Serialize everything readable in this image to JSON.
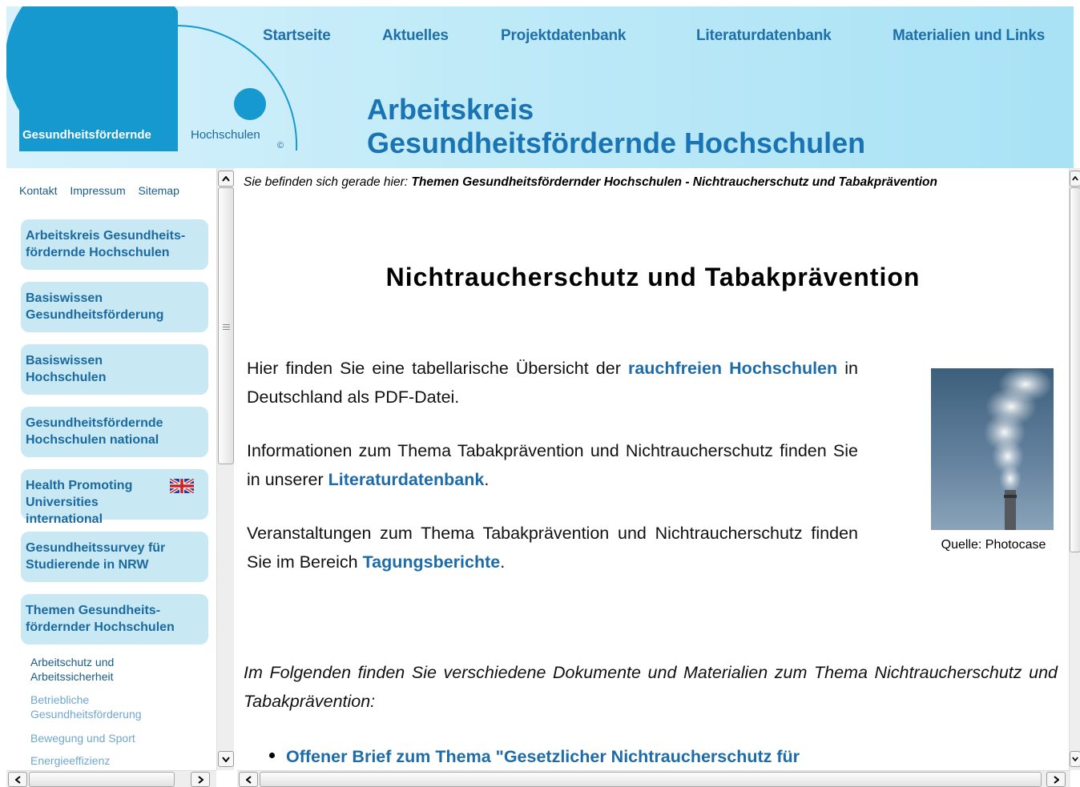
{
  "header": {
    "logo": {
      "left_text": "Gesundheitsfördernde",
      "right_text": "Hochschulen",
      "copyright": "©"
    },
    "nav": [
      "Startseite",
      "Aktuelles",
      "Projektdatenbank",
      "Literaturdatenbank",
      "Materialien und Links"
    ],
    "title_line1": "Arbeitskreis",
    "title_line2": "Gesundheitsfördernde Hochschulen"
  },
  "sidebar": {
    "util_links": [
      "Kontakt",
      "Impressum",
      "Sitemap"
    ],
    "boxes": [
      "Arbeitskreis Gesundheits- fördernde Hochschulen",
      "Basiswissen Gesundheitsförderung",
      "Basiswissen Hochschulen",
      "Gesundheitsfördernde Hochschulen national",
      "Health Promoting Universities international",
      "Gesundheitssurvey für Studierende in NRW",
      "Themen Gesundheits- fördernder Hochschulen"
    ],
    "subitems": [
      "Arbeitschutz und Arbeitssicherheit",
      "Betriebliche Gesundheitsförderung",
      "Bewegung und Sport",
      "Energieeffizienz"
    ]
  },
  "main": {
    "breadcrumb_prefix": "Sie befinden sich gerade hier:",
    "breadcrumb_path": "Themen Gesundheitsfördernder Hochschulen - Nichtraucherschutz und Tabakprävention",
    "heading": "Nichtraucherschutz und Tabakprävention",
    "p1_before": "Hier finden Sie eine tabellarische Übersicht der ",
    "p1_link": "rauchfreien Hochschulen",
    "p1_after": " in Deutschland als PDF-Datei.",
    "p2_before": "Informationen zum Thema Tabakprävention und Nichtraucherschutz finden Sie in unserer ",
    "p2_link": "Literaturdatenbank",
    "p2_after": ".",
    "p3_before": "Veranstaltungen zum Thema Tabakprävention und Nichtraucherschutz finden Sie im Bereich ",
    "p3_link": "Tagungsberichte",
    "p3_after": ".",
    "photo_caption": "Quelle: Photocase",
    "intro": "Im Folgenden finden Sie verschiedene Dokumente und Materialien zum Thema Nichtraucherschutz und Tabakprävention:",
    "doc_link": "Offener Brief zum Thema \"Gesetzlicher Nichtraucherschutz für"
  },
  "colors": {
    "header_bg": "#bfeaf8",
    "logo_blue": "#1699cf",
    "link_blue": "#1d6ba8",
    "nav_box_bg": "#c8e8f3"
  },
  "icons": {
    "flag": "uk-flag-icon",
    "scroll_up": "arrow-up-icon",
    "scroll_down": "arrow-down-icon",
    "scroll_left": "arrow-left-icon",
    "scroll_right": "arrow-right-icon"
  }
}
